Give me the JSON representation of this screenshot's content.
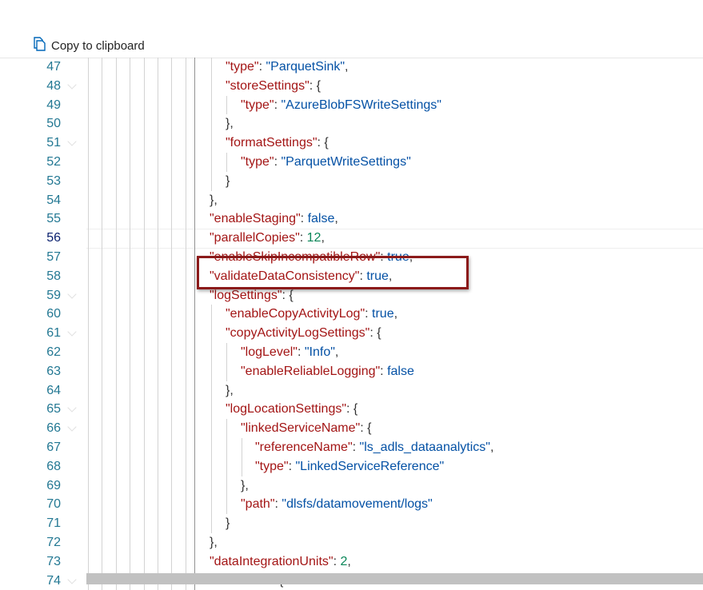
{
  "toolbar": {
    "copy_label": "Copy to clipboard",
    "copy_icon": "copy-icon"
  },
  "editor": {
    "current_line": "56",
    "highlighted_line": "58",
    "lines": [
      {
        "n": "47",
        "indent": 2,
        "fold": false,
        "tokens": [
          {
            "t": "k",
            "v": "\"type\""
          },
          {
            "t": "p",
            "v": ": "
          },
          {
            "t": "s",
            "v": "\"ParquetSink\""
          },
          {
            "t": "p",
            "v": ","
          }
        ]
      },
      {
        "n": "48",
        "indent": 2,
        "fold": true,
        "tokens": [
          {
            "t": "k",
            "v": "\"storeSettings\""
          },
          {
            "t": "p",
            "v": ": {"
          }
        ]
      },
      {
        "n": "49",
        "indent": 3,
        "fold": false,
        "tokens": [
          {
            "t": "k",
            "v": "\"type\""
          },
          {
            "t": "p",
            "v": ": "
          },
          {
            "t": "s",
            "v": "\"AzureBlobFSWriteSettings\""
          }
        ]
      },
      {
        "n": "50",
        "indent": 2,
        "fold": false,
        "tokens": [
          {
            "t": "p",
            "v": "},"
          }
        ]
      },
      {
        "n": "51",
        "indent": 2,
        "fold": true,
        "tokens": [
          {
            "t": "k",
            "v": "\"formatSettings\""
          },
          {
            "t": "p",
            "v": ": {"
          }
        ]
      },
      {
        "n": "52",
        "indent": 3,
        "fold": false,
        "tokens": [
          {
            "t": "k",
            "v": "\"type\""
          },
          {
            "t": "p",
            "v": ": "
          },
          {
            "t": "s",
            "v": "\"ParquetWriteSettings\""
          }
        ]
      },
      {
        "n": "53",
        "indent": 2,
        "fold": false,
        "tokens": [
          {
            "t": "p",
            "v": "}"
          }
        ]
      },
      {
        "n": "54",
        "indent": 1,
        "fold": false,
        "tokens": [
          {
            "t": "p",
            "v": "},"
          }
        ]
      },
      {
        "n": "55",
        "indent": 1,
        "fold": false,
        "tokens": [
          {
            "t": "k",
            "v": "\"enableStaging\""
          },
          {
            "t": "p",
            "v": ": "
          },
          {
            "t": "b",
            "v": "false"
          },
          {
            "t": "p",
            "v": ","
          }
        ]
      },
      {
        "n": "56",
        "indent": 1,
        "fold": false,
        "tokens": [
          {
            "t": "k",
            "v": "\"parallelCopies\""
          },
          {
            "t": "p",
            "v": ": "
          },
          {
            "t": "n",
            "v": "12"
          },
          {
            "t": "p",
            "v": ","
          }
        ]
      },
      {
        "n": "57",
        "indent": 1,
        "fold": false,
        "tokens": [
          {
            "t": "k",
            "v": "\"enableSkipIncompatibleRow\""
          },
          {
            "t": "p",
            "v": ": "
          },
          {
            "t": "b",
            "v": "true"
          },
          {
            "t": "p",
            "v": ","
          }
        ]
      },
      {
        "n": "58",
        "indent": 1,
        "fold": false,
        "tokens": [
          {
            "t": "k",
            "v": "\"validateDataConsistency\""
          },
          {
            "t": "p",
            "v": ": "
          },
          {
            "t": "b",
            "v": "true"
          },
          {
            "t": "p",
            "v": ","
          }
        ]
      },
      {
        "n": "59",
        "indent": 1,
        "fold": true,
        "tokens": [
          {
            "t": "k",
            "v": "\"logSettings\""
          },
          {
            "t": "p",
            "v": ": {"
          }
        ]
      },
      {
        "n": "60",
        "indent": 2,
        "fold": false,
        "tokens": [
          {
            "t": "k",
            "v": "\"enableCopyActivityLog\""
          },
          {
            "t": "p",
            "v": ": "
          },
          {
            "t": "b",
            "v": "true"
          },
          {
            "t": "p",
            "v": ","
          }
        ]
      },
      {
        "n": "61",
        "indent": 2,
        "fold": true,
        "tokens": [
          {
            "t": "k",
            "v": "\"copyActivityLogSettings\""
          },
          {
            "t": "p",
            "v": ": {"
          }
        ]
      },
      {
        "n": "62",
        "indent": 3,
        "fold": false,
        "tokens": [
          {
            "t": "k",
            "v": "\"logLevel\""
          },
          {
            "t": "p",
            "v": ": "
          },
          {
            "t": "s",
            "v": "\"Info\""
          },
          {
            "t": "p",
            "v": ","
          }
        ]
      },
      {
        "n": "63",
        "indent": 3,
        "fold": false,
        "tokens": [
          {
            "t": "k",
            "v": "\"enableReliableLogging\""
          },
          {
            "t": "p",
            "v": ": "
          },
          {
            "t": "b",
            "v": "false"
          }
        ]
      },
      {
        "n": "64",
        "indent": 2,
        "fold": false,
        "tokens": [
          {
            "t": "p",
            "v": "},"
          }
        ]
      },
      {
        "n": "65",
        "indent": 2,
        "fold": true,
        "tokens": [
          {
            "t": "k",
            "v": "\"logLocationSettings\""
          },
          {
            "t": "p",
            "v": ": {"
          }
        ]
      },
      {
        "n": "66",
        "indent": 3,
        "fold": true,
        "tokens": [
          {
            "t": "k",
            "v": "\"linkedServiceName\""
          },
          {
            "t": "p",
            "v": ": {"
          }
        ]
      },
      {
        "n": "67",
        "indent": 4,
        "fold": false,
        "tokens": [
          {
            "t": "k",
            "v": "\"referenceName\""
          },
          {
            "t": "p",
            "v": ": "
          },
          {
            "t": "s",
            "v": "\"ls_adls_dataanalytics\""
          },
          {
            "t": "p",
            "v": ","
          }
        ]
      },
      {
        "n": "68",
        "indent": 4,
        "fold": false,
        "tokens": [
          {
            "t": "k",
            "v": "\"type\""
          },
          {
            "t": "p",
            "v": ": "
          },
          {
            "t": "s",
            "v": "\"LinkedServiceReference\""
          }
        ]
      },
      {
        "n": "69",
        "indent": 3,
        "fold": false,
        "tokens": [
          {
            "t": "p",
            "v": "},"
          }
        ]
      },
      {
        "n": "70",
        "indent": 3,
        "fold": false,
        "tokens": [
          {
            "t": "k",
            "v": "\"path\""
          },
          {
            "t": "p",
            "v": ": "
          },
          {
            "t": "s",
            "v": "\"dlsfs/datamovement/logs\""
          }
        ]
      },
      {
        "n": "71",
        "indent": 2,
        "fold": false,
        "tokens": [
          {
            "t": "p",
            "v": "}"
          }
        ]
      },
      {
        "n": "72",
        "indent": 1,
        "fold": false,
        "tokens": [
          {
            "t": "p",
            "v": "},"
          }
        ]
      },
      {
        "n": "73",
        "indent": 1,
        "fold": false,
        "tokens": [
          {
            "t": "k",
            "v": "\"dataIntegrationUnits\""
          },
          {
            "t": "p",
            "v": ": "
          },
          {
            "t": "n",
            "v": "2"
          },
          {
            "t": "p",
            "v": ","
          }
        ]
      },
      {
        "n": "74",
        "indent": 1,
        "fold": true,
        "tokens": [
          {
            "t": "k",
            "v": "\"translator\""
          },
          {
            "t": "p",
            "v": ": {"
          }
        ]
      }
    ]
  }
}
